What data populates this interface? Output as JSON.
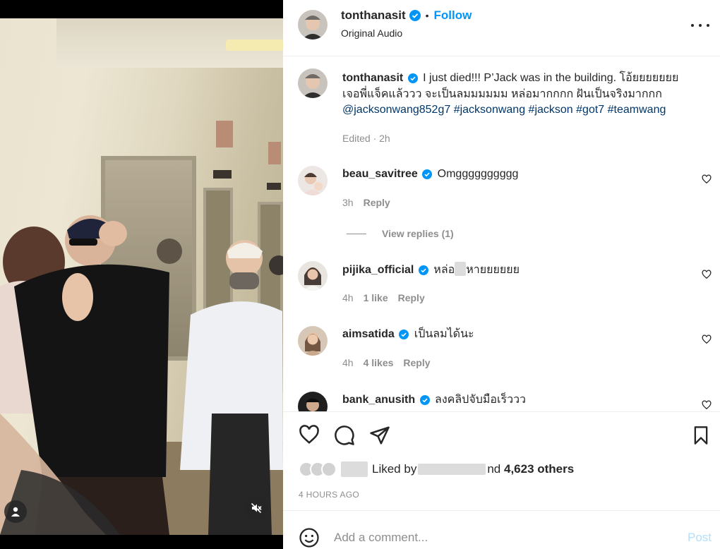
{
  "post": {
    "author": "tonthanasit",
    "audio_label": "Original Audio",
    "follow_label": "Follow",
    "separator": "•"
  },
  "caption": {
    "username": "tonthanasit",
    "text": "I just died!!! P’Jack was in the building. โอ้ยยยยยยย",
    "line2": "เจอพี่แจ็คแล้ววว จะเป็นลมมมมมม หล่อมากกกก ฝันเป็นจริงมากกก",
    "tags": [
      "@jacksonwang852g7",
      "#jacksonwang",
      "#jackson",
      "#got7",
      "#teamwang"
    ],
    "meta": "Edited · 2h"
  },
  "comments": [
    {
      "username": "beau_savitree",
      "text": "Omgggggggggg",
      "time": "3h",
      "likes": "",
      "reply_label": "Reply",
      "view_replies": "View replies (1)"
    },
    {
      "username": "pijika_official",
      "text_before": "หล่อ",
      "text_after": "หายยยยยย",
      "time": "4h",
      "likes": "1 like",
      "reply_label": "Reply"
    },
    {
      "username": "aimsatida",
      "text": "เป็นลมได้นะ",
      "time": "4h",
      "likes": "4 likes",
      "reply_label": "Reply"
    },
    {
      "username": "bank_anusith",
      "text": "ลงคลิปจับมือเร็ววว"
    }
  ],
  "likes": {
    "prefix": "Liked by",
    "suffix": "nd",
    "count": "4,623 others"
  },
  "time_ago": "4 HOURS AGO",
  "add_comment": {
    "placeholder": "Add a comment...",
    "post_label": "Post"
  },
  "icons": {
    "verified": "verified-badge-icon",
    "more": "more-options-icon",
    "like": "heart-icon",
    "comment": "comment-bubble-icon",
    "share": "paper-plane-icon",
    "save": "bookmark-icon",
    "emoji": "emoji-smile-icon",
    "user_tags": "user-tag-icon",
    "mute": "muted-speaker-icon"
  },
  "colors": {
    "accent": "#0095f6",
    "verified": "#0095f6",
    "link": "#00376b",
    "secondary_text": "#8e8e8e",
    "post_disabled": "#b2dffc"
  }
}
